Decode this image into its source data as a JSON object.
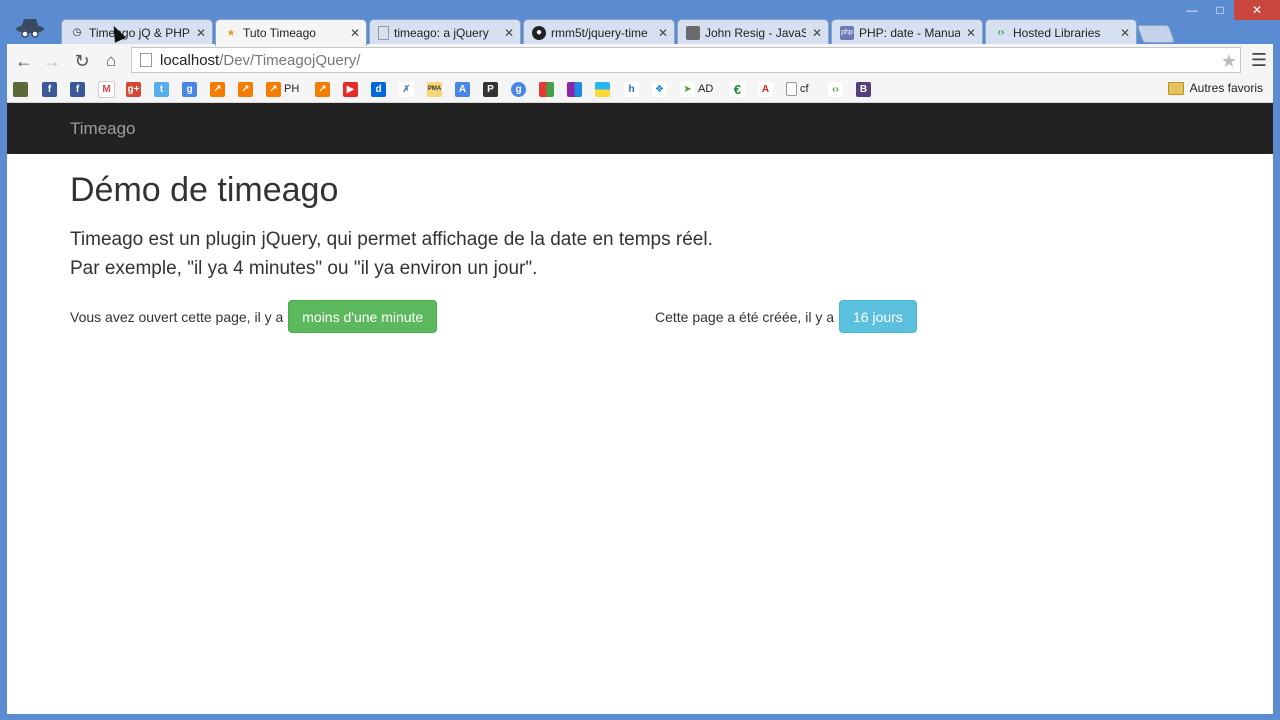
{
  "browser": {
    "tabs": [
      {
        "title": "Timeago jQ & PHP",
        "favicon": "clock-icon",
        "active": false
      },
      {
        "title": "Tuto Timeago",
        "favicon": "star-logo-icon",
        "active": true
      },
      {
        "title": "timeago: a jQuery",
        "favicon": "page-icon",
        "active": false
      },
      {
        "title": "rmm5t/jquery-time",
        "favicon": "github-icon",
        "active": false
      },
      {
        "title": "John Resig - JavaSc",
        "favicon": "avatar-icon",
        "active": false
      },
      {
        "title": "PHP: date - Manua",
        "favicon": "php-icon",
        "active": false
      },
      {
        "title": "Hosted Libraries",
        "favicon": "google-dev-icon",
        "active": false
      }
    ],
    "address": {
      "host": "localhost",
      "path": "/Dev/TimeagojQuery/"
    },
    "bookmarks": [
      {
        "icon": "generic-icon",
        "text": ""
      },
      {
        "icon": "facebook-icon",
        "text": ""
      },
      {
        "icon": "facebook-icon",
        "text": ""
      },
      {
        "icon": "gmail-icon",
        "text": ""
      },
      {
        "icon": "google-plus-icon",
        "text": ""
      },
      {
        "icon": "twitter-icon",
        "text": ""
      },
      {
        "icon": "google-icon",
        "text": ""
      },
      {
        "icon": "analytics-icon",
        "text": ""
      },
      {
        "icon": "analytics-icon",
        "text": ""
      },
      {
        "icon": "analytics-icon",
        "text": "PH"
      },
      {
        "icon": "analytics-icon",
        "text": ""
      },
      {
        "icon": "youtube-icon",
        "text": ""
      },
      {
        "icon": "dailymotion-icon",
        "text": ""
      },
      {
        "icon": "tool-icon",
        "text": ""
      },
      {
        "icon": "pma-icon",
        "text": ""
      },
      {
        "icon": "translate-icon",
        "text": ""
      },
      {
        "icon": "pocket-icon",
        "text": ""
      },
      {
        "icon": "google-icon",
        "text": ""
      },
      {
        "icon": "apps-icon",
        "text": ""
      },
      {
        "icon": "grid-icon",
        "text": ""
      },
      {
        "icon": "color-grid-icon",
        "text": ""
      },
      {
        "icon": "h-icon",
        "text": ""
      },
      {
        "icon": "dropbox-icon",
        "text": ""
      },
      {
        "icon": "bird-icon",
        "text": "AD"
      },
      {
        "icon": "euro-icon",
        "text": ""
      },
      {
        "icon": "adobe-icon",
        "text": ""
      },
      {
        "icon": "page-icon",
        "text": "cf"
      },
      {
        "icon": "chrome-dev-icon",
        "text": ""
      },
      {
        "icon": "bootstrap-icon",
        "text": ""
      }
    ],
    "bookmarks_folder": "Autres favoris"
  },
  "page": {
    "brand": "Timeago",
    "title": "Démo de timeago",
    "lead_line1": "Timeago est un plugin jQuery, qui permet affichage de la date en temps réel.",
    "lead_line2": "Par exemple, \"il ya 4 minutes\" ou \"il ya environ un jour\".",
    "opened_label": "Vous avez ouvert cette page, il y a",
    "opened_value": "moins d'une minute",
    "created_label": "Cette page a été créée, il y a",
    "created_value": "16 jours"
  },
  "colors": {
    "navbar": "#222222",
    "success": "#5cb85c",
    "info": "#5bc0de",
    "frame": "#5b8bd0"
  }
}
